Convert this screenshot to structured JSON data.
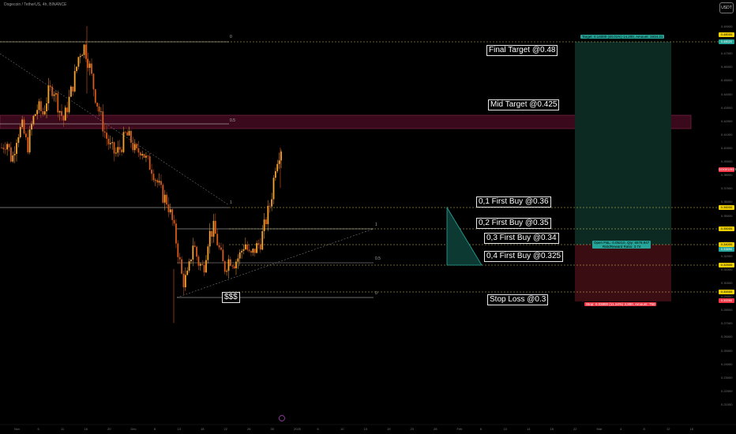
{
  "header": {
    "symbol_line": "Dogecoin / TetherUS, 4h, BINANCE",
    "currency_button": "USDT"
  },
  "annotations": {
    "final_target": "Final Target @0.48",
    "mid_target": "Mid Target @0.425",
    "first_buy_1": "0,1 First Buy @0.36",
    "first_buy_2": "0,2 First Buy @0.35",
    "first_buy_3": "0,3 First Buy @0.34",
    "first_buy_4": "0,4 First Buy @0.325",
    "stop_loss": "Stop Loss @0.3",
    "liquidity": "$$$"
  },
  "fib_labels": {
    "top_0": "0",
    "top_05": "0.5",
    "top_1": "1",
    "low_1": "1",
    "low_05": "0.5",
    "low_0": "0"
  },
  "position": {
    "target_text": "Target: 0.14000 (40.01%) 14,200, Amount: 1934.21",
    "open_pnl_text": "Open P&L: 0.05210, Qty: 6578.947",
    "risk_reward_text": "Risk/Reward Ratio: 3.74",
    "stop_text": "Stop: 0.03800 (11.24%) 3,800, Amount: 750"
  },
  "price_axis": {
    "labels": [
      "0.49000",
      "0.48000",
      "0.47000",
      "0.46000",
      "0.45000",
      "0.44000",
      "0.43000",
      "0.42000",
      "0.41000",
      "0.40000",
      "0.39000",
      "0.38000",
      "0.37000",
      "0.36000",
      "0.35000",
      "0.34000",
      "0.33000",
      "0.32000",
      "0.31000",
      "0.30000",
      "0.29000",
      "0.28000",
      "0.27000",
      "0.26000",
      "0.25000",
      "0.24000",
      "0.23000",
      "0.22000",
      "0.21000"
    ],
    "tags": [
      {
        "text": "0.48000",
        "color": "#f0d000"
      },
      {
        "text": "0.48020",
        "color": "#26a69a"
      },
      {
        "text": "DOGEUSDT",
        "color": "#f23645"
      },
      {
        "text": "0.36000",
        "color": "#f0d000"
      },
      {
        "text": "0.35000",
        "color": "#f0d000"
      },
      {
        "text": "0.34000",
        "color": "#f0d000"
      },
      {
        "text": "0.33890",
        "color": "#26a69a"
      },
      {
        "text": "0.32500",
        "color": "#f0d000"
      },
      {
        "text": "0.30000",
        "color": "#f0d000"
      },
      {
        "text": "0.30090",
        "color": "#f23645"
      }
    ]
  },
  "time_axis": [
    "Nov",
    "6",
    "11",
    "16",
    "20",
    "Dec",
    "8",
    "13",
    "18",
    "22",
    "26",
    "30",
    "2025",
    "6",
    "10",
    "15",
    "19",
    "23",
    "28",
    "Feb",
    "6",
    "10",
    "14",
    "18",
    "22",
    "Mar",
    "4",
    "8",
    "12",
    "16"
  ],
  "colors": {
    "up": "#f7a530",
    "down": "#d85a1a",
    "target_zone": "#0d2b22",
    "stop_zone": "#3a0d12",
    "mid_zone": "#3c0a1c",
    "dotted": "#d4c860"
  },
  "chart_data": {
    "type": "candlestick",
    "symbol": "DOGEUSDT",
    "interval": "4h",
    "ylim": [
      0.21,
      0.49
    ],
    "close_path": [
      0.4,
      0.405,
      0.39,
      0.41,
      0.415,
      0.4,
      0.42,
      0.43,
      0.425,
      0.44,
      0.445,
      0.43,
      0.42,
      0.435,
      0.45,
      0.47,
      0.475,
      0.46,
      0.44,
      0.425,
      0.41,
      0.4,
      0.395,
      0.4,
      0.41,
      0.405,
      0.395,
      0.4,
      0.39,
      0.385,
      0.375,
      0.365,
      0.36,
      0.345,
      0.325,
      0.3,
      0.305,
      0.33,
      0.315,
      0.31,
      0.335,
      0.34,
      0.325,
      0.31,
      0.318,
      0.315,
      0.32,
      0.33,
      0.318,
      0.325,
      0.33,
      0.345,
      0.36,
      0.39,
      0.4
    ]
  }
}
